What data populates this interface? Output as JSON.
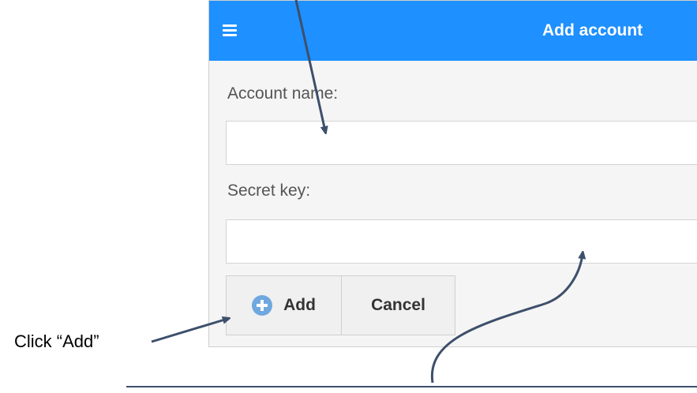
{
  "header": {
    "menu_icon": "hamburger-icon",
    "title": "Add account"
  },
  "form": {
    "account_name_label": "Account name:",
    "account_name_value": "",
    "secret_key_label": "Secret key:",
    "secret_key_value": ""
  },
  "buttons": {
    "add_icon": "plus-circle-icon",
    "add_label": "Add",
    "cancel_label": "Cancel"
  },
  "annotations": {
    "click_add": "Click “Add”"
  },
  "colors": {
    "header_bg": "#1e90ff",
    "add_icon": "#6ea8df",
    "arrow": "#3d4f6b"
  }
}
